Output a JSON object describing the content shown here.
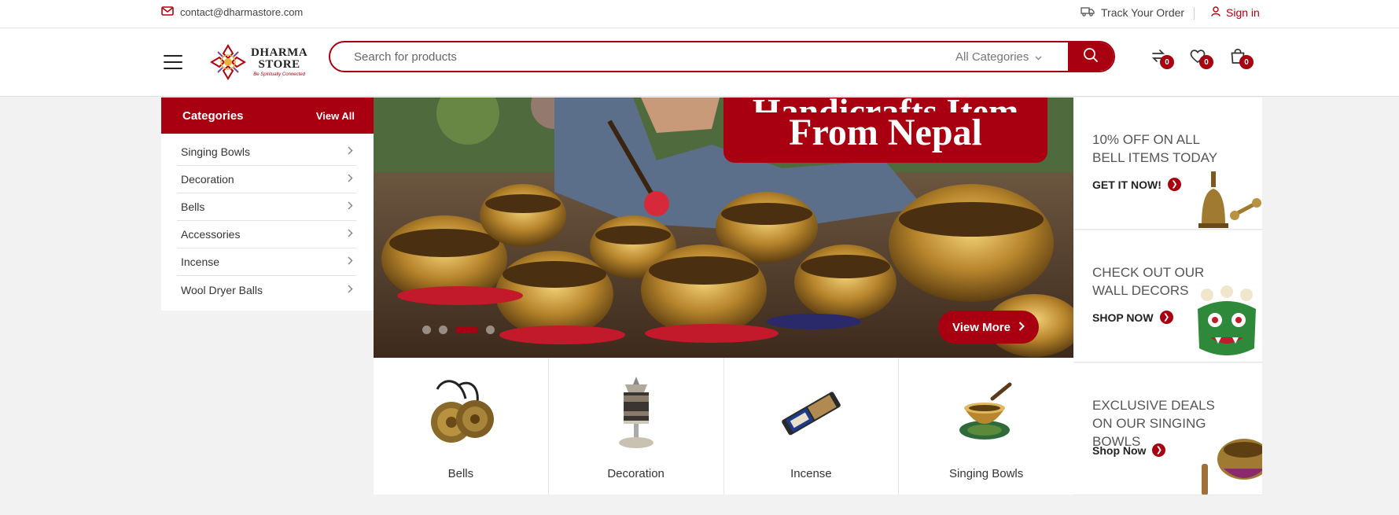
{
  "topbar": {
    "email": "contact@dharmastore.com",
    "track_order": "Track Your Order",
    "sign_in": "Sign in"
  },
  "header": {
    "logo_line1": "DHARMA",
    "logo_line2": "STORE",
    "logo_tagline": "Be Spiritually Connected",
    "search_placeholder": "Search for products",
    "category_select": "All Categories",
    "compare_count": "0",
    "wishlist_count": "0",
    "cart_count": "0"
  },
  "sidebar": {
    "title": "Categories",
    "view_all": "View All",
    "items": [
      {
        "label": "Singing Bowls"
      },
      {
        "label": "Decoration"
      },
      {
        "label": "Bells"
      },
      {
        "label": "Accessories"
      },
      {
        "label": "Incense"
      },
      {
        "label": "Wool Dryer Balls"
      }
    ]
  },
  "hero": {
    "banner_line1": "Handicrafts Item",
    "banner_line2": "From Nepal",
    "button": "View More",
    "slides": 4,
    "active_slide": 3
  },
  "tiles": [
    {
      "label": "Bells"
    },
    {
      "label": "Decoration"
    },
    {
      "label": "Incense"
    },
    {
      "label": "Singing Bowls"
    }
  ],
  "promos": [
    {
      "title": "10% OFF ON ALL BELL ITEMS TODAY",
      "cta": "GET IT NOW!"
    },
    {
      "title": "CHECK OUT OUR WALL DECORS",
      "cta": "SHOP NOW"
    },
    {
      "title": "EXCLUSIVE DEALS ON OUR SINGING BOWLS",
      "cta": "Shop Now"
    }
  ],
  "colors": {
    "brand": "#a80010",
    "background": "#f2f2f2"
  }
}
